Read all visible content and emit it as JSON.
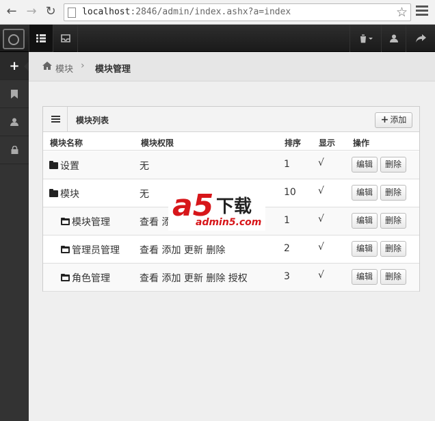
{
  "browser": {
    "url_host": "localhost",
    "url_rest": ":2846/admin/index.ashx?a=index"
  },
  "breadcrumb": {
    "home": "模块",
    "current": "模块管理"
  },
  "panel": {
    "title": "模块列表",
    "add_label": "添加"
  },
  "table": {
    "headers": [
      "模块名称",
      "模块权限",
      "排序",
      "显示",
      "操作"
    ],
    "rows": [
      {
        "name": "设置",
        "perms": "无",
        "sort": "1",
        "show": "√",
        "level": 0
      },
      {
        "name": "模块",
        "perms": "无",
        "sort": "10",
        "show": "√",
        "level": 0
      },
      {
        "name": "模块管理",
        "perms": "查看 添",
        "sort": "1",
        "show": "√",
        "level": 1
      },
      {
        "name": "管理员管理",
        "perms": "查看  添加  更新  删除",
        "sort": "2",
        "show": "√",
        "level": 1
      },
      {
        "name": "角色管理",
        "perms": "查看  添加  更新  删除  授权",
        "sort": "3",
        "show": "√",
        "level": 1
      }
    ],
    "edit_label": "编辑",
    "delete_label": "删除"
  },
  "watermark": {
    "big": "a5",
    "dl": "下载",
    "site": "admin5.com"
  }
}
